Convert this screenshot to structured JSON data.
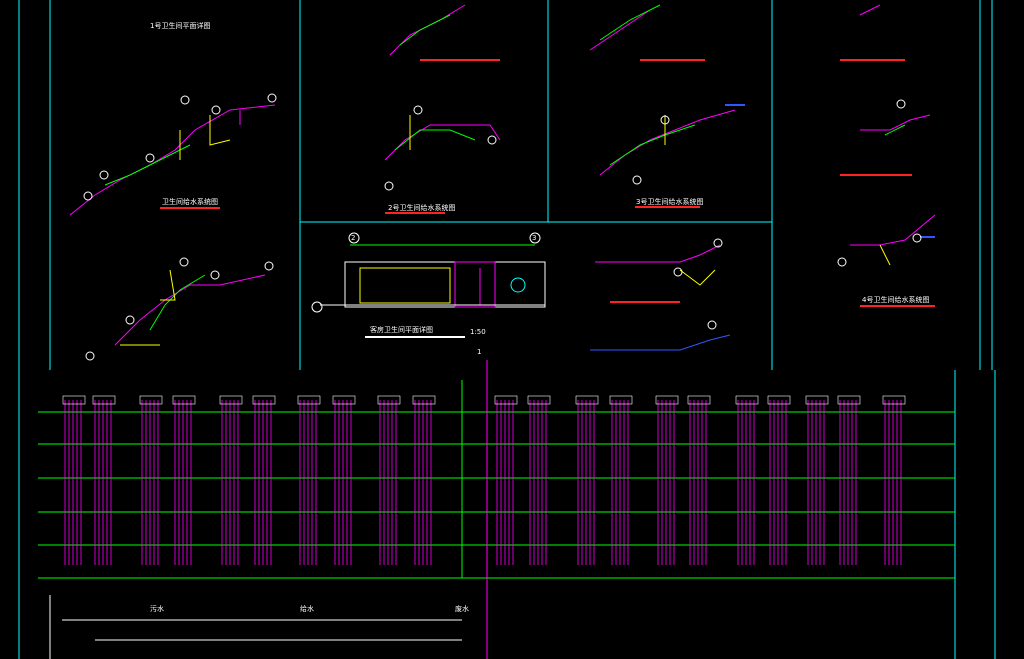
{
  "drawing": {
    "background": "#000000",
    "colors": {
      "frame": "#00ffff",
      "pipe_supply": "#ff00ff",
      "pipe_green": "#00ff00",
      "pipe_yellow": "#ffff00",
      "pipe_blue": "#3355ff",
      "underline_red": "#ff2222",
      "text": "#ffffff"
    },
    "views": [
      {
        "id": "v1",
        "title": "1号卫生间平面详图"
      },
      {
        "id": "v2",
        "title": "卫生间给水系统图"
      },
      {
        "id": "v3",
        "title": "2号卫生间给水系统图"
      },
      {
        "id": "v4",
        "title": "3号卫生间给水系统图"
      },
      {
        "id": "v5",
        "title": "客房卫生间平面详图"
      },
      {
        "id": "v6",
        "title": "4号卫生间给水系统图"
      }
    ],
    "plan_scale": "1:50",
    "axis_marks": [
      "2",
      "3"
    ],
    "riser_floor_tag": "1",
    "bottom_labels": [
      "污水",
      "给水",
      "废水"
    ]
  }
}
